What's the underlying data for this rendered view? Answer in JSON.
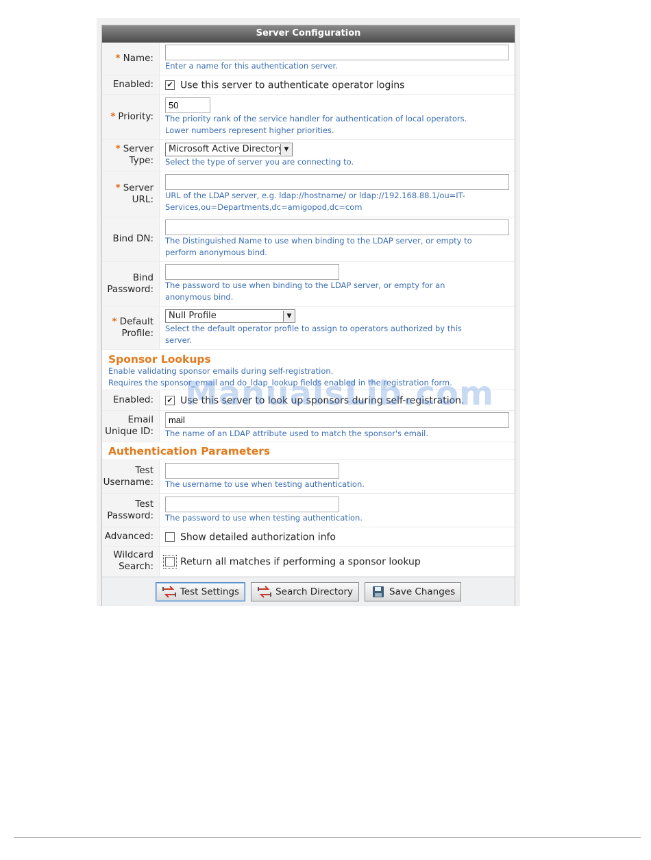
{
  "panel_title": "Server Configuration",
  "fields": {
    "name": {
      "label": "Name:",
      "required": true,
      "value": "",
      "help": "Enter a name for this authentication server."
    },
    "enabled": {
      "label": "Enabled:",
      "checked": true,
      "checkbox_label": "Use this server to authenticate operator logins"
    },
    "priority": {
      "label": "Priority:",
      "required": true,
      "value": "50",
      "help1": "The priority rank of the service handler for authentication of local operators.",
      "help2": "Lower numbers represent higher priorities."
    },
    "server_type": {
      "label1": "Server",
      "label2": "Type:",
      "required": true,
      "selected": "Microsoft Active Directory",
      "help": "Select the type of server you are connecting to."
    },
    "server_url": {
      "label1": "Server",
      "label2": "URL:",
      "required": true,
      "value": "",
      "help1": "URL of the LDAP server, e.g. ldap://hostname/ or ldap://192.168.88.1/ou=IT-",
      "help2": "Services,ou=Departments,dc=amigopod,dc=com"
    },
    "bind_dn": {
      "label": "Bind DN:",
      "value": "",
      "help1": "The Distinguished Name to use when binding to the LDAP server, or empty to",
      "help2": "perform anonymous bind."
    },
    "bind_password": {
      "label1": "Bind",
      "label2": "Password:",
      "value": "",
      "help1": "The password to use when binding to the LDAP server, or empty for an",
      "help2": "anonymous bind."
    },
    "default_profile": {
      "label1": "Default",
      "label2": "Profile:",
      "required": true,
      "selected": "Null Profile",
      "help1": "Select the default operator profile to assign to operators authorized by this",
      "help2": "server."
    }
  },
  "sponsor": {
    "heading": "Sponsor Lookups",
    "desc1": "Enable validating sponsor emails during self-registration.",
    "desc2": "Requires the sponsor_email and do_ldap_lookup fields enabled in the registration form.",
    "enabled_label": "Enabled:",
    "enabled_checked": true,
    "enabled_checkbox_label": "Use this server to look up sponsors during self-registration.",
    "email_label1": "Email",
    "email_label2": "Unique ID:",
    "email_value": "mail",
    "email_help": "The name of an LDAP attribute used to match the sponsor's email."
  },
  "auth": {
    "heading": "Authentication Parameters",
    "test_user_label1": "Test",
    "test_user_label2": "Username:",
    "test_user_help": "The username to use when testing authentication.",
    "test_pass_label1": "Test",
    "test_pass_label2": "Password:",
    "test_pass_help": "The password to use when testing authentication.",
    "advanced_label": "Advanced:",
    "advanced_checked": false,
    "advanced_checkbox_label": "Show detailed authorization info",
    "wildcard_label1": "Wildcard",
    "wildcard_label2": "Search:",
    "wildcard_checked": false,
    "wildcard_checkbox_label": "Return all matches if performing a sponsor lookup"
  },
  "buttons": {
    "test": "Test Settings",
    "search": "Search Directory",
    "save": "Save Changes"
  },
  "watermark": "ManualsLib.com",
  "icons": {
    "required": "asterisk-icon",
    "test": "transfer-arrows-icon",
    "search": "transfer-arrows-icon",
    "save": "floppy-disk-icon"
  }
}
